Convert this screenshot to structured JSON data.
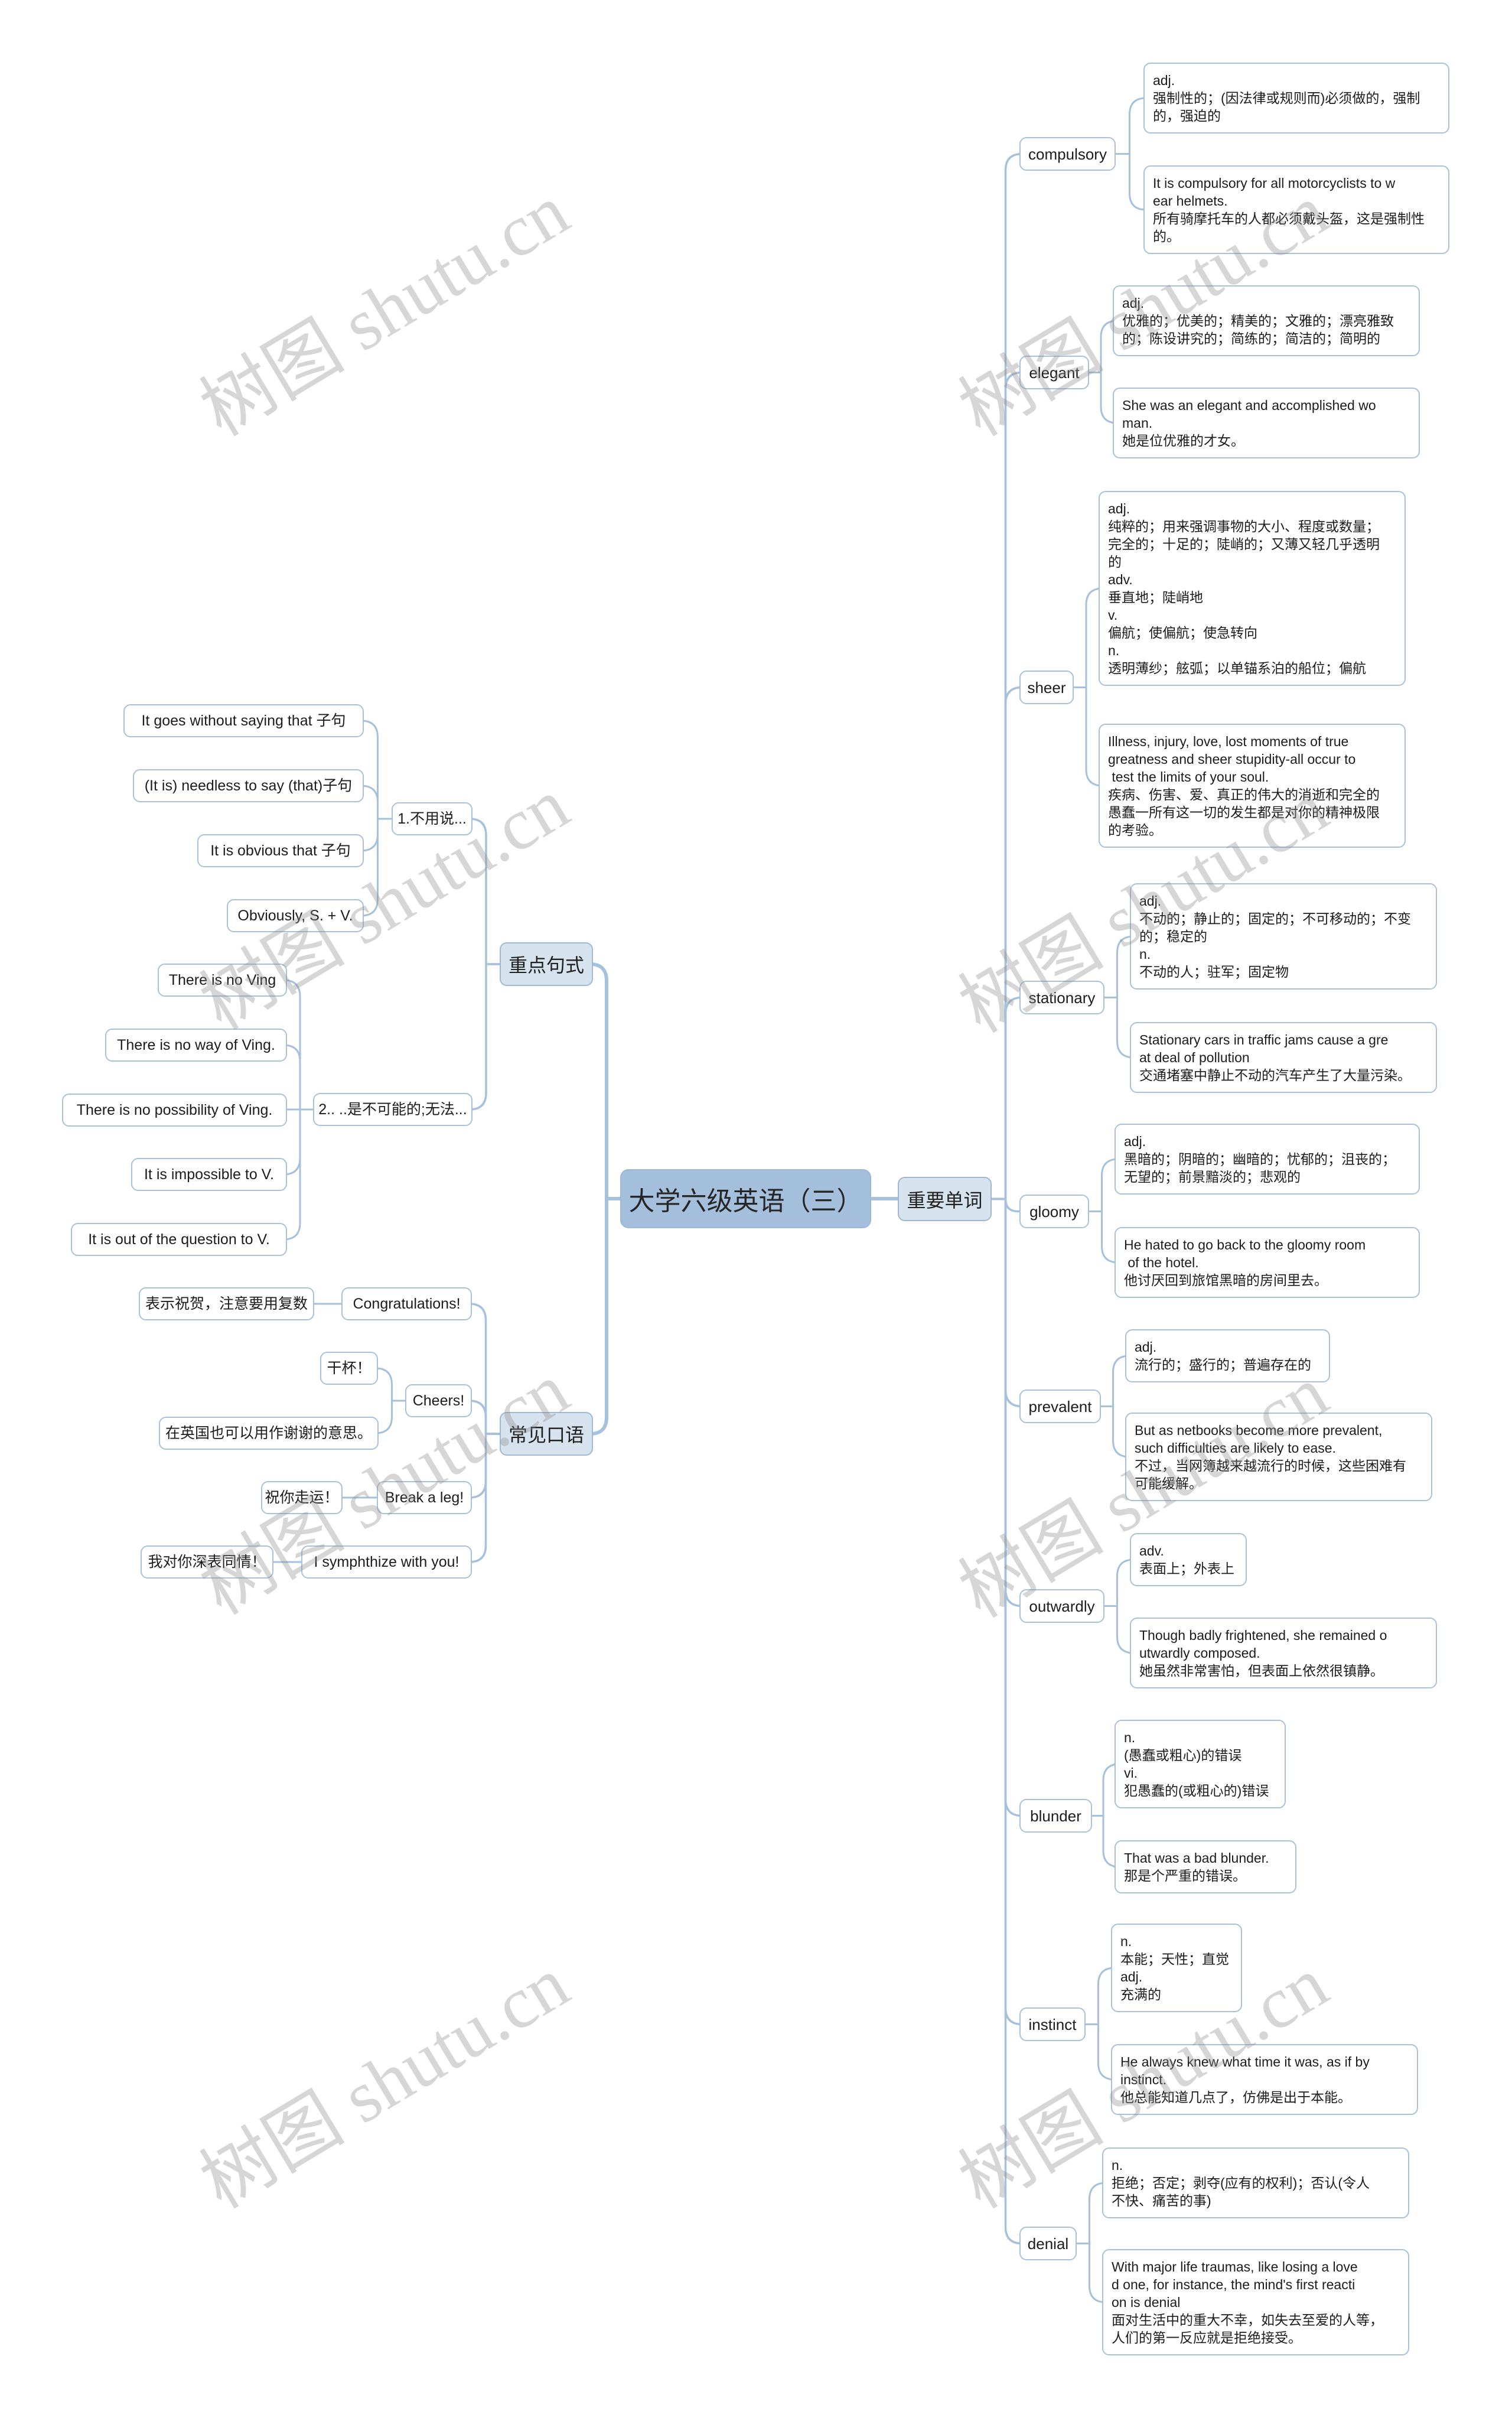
{
  "title": "大学六级英语（三）",
  "watermark": "树图 shutu.cn",
  "theme": {
    "central_fill": "#a3bfdc",
    "branch_fill": "#d6e2ed",
    "node_border": "#a9c1d9",
    "connector": "#a6c1db"
  },
  "key_sentences": {
    "label": "重点句式",
    "groups": [
      {
        "label": "1.不用说...",
        "patterns": [
          "It goes without saying that 子句",
          "(It is) needless to say (that)子句",
          "It is obvious that 子句",
          "Obviously, S. + V."
        ]
      },
      {
        "label": "2.. ..是不可能的;无法...",
        "patterns": [
          "There is no Ving",
          "There is no way of Ving.",
          "There is no possibility of Ving.",
          "It is impossible to V.",
          "It is out of the question to V."
        ]
      }
    ]
  },
  "common_phrases": {
    "label": "常见口语",
    "items": [
      {
        "phrase": "Congratulations!",
        "notes": [
          "表示祝贺，注意要用复数"
        ]
      },
      {
        "phrase": "Cheers!",
        "notes": [
          "干杯！",
          "在英国也可以用作谢谢的意思。"
        ]
      },
      {
        "phrase": "Break a leg!",
        "notes": [
          "祝你走运！"
        ]
      },
      {
        "phrase": "I symphthize with you!",
        "notes": [
          "我对你深表同情！"
        ]
      }
    ]
  },
  "important_words": {
    "label": "重要单词",
    "items": [
      {
        "word": "compulsory",
        "definition": "adj.\n强制性的；(因法律或规则而)必须做的，强制\n的，强迫的",
        "example": "It is compulsory for all motorcyclists to w\near helmets.\n所有骑摩托车的人都必须戴头盔，这是强制性\n的。"
      },
      {
        "word": "elegant",
        "definition": "adj.\n优雅的；优美的；精美的；文雅的；漂亮雅致\n的；陈设讲究的；简练的；简洁的；简明的",
        "example": "She was an elegant and accomplished wo\nman.\n她是位优雅的才女。"
      },
      {
        "word": "sheer",
        "definition": "adj.\n纯粹的；用来强调事物的大小、程度或数量；\n完全的；十足的；陡峭的；又薄又轻几乎透明\n的\nadv.\n垂直地；陡峭地\nv.\n偏航；使偏航；使急转向\nn.\n透明薄纱；舷弧；以单锚系泊的船位；偏航",
        "example": "Illness, injury, love, lost moments of true\ngreatness and sheer stupidity-all occur to\n test the limits of your soul.\n疾病、伤害、爱、真正的伟大的消逝和完全的\n愚蠢一所有这一切的发生都是对你的精神极限\n的考验。"
      },
      {
        "word": "stationary",
        "definition": "adj.\n不动的；静止的；固定的；不可移动的；不变\n的；稳定的\nn.\n不动的人；驻军；固定物",
        "example": "Stationary cars in traffic jams cause a gre\nat deal of pollution\n交通堵塞中静止不动的汽车产生了大量污染。"
      },
      {
        "word": "gloomy",
        "definition": "adj.\n黑暗的；阴暗的；幽暗的；忧郁的；沮丧的；\n无望的；前景黯淡的；悲观的",
        "example": "He hated to go back to the gloomy room\n of the hotel.\n他讨厌回到旅馆黑暗的房间里去。"
      },
      {
        "word": "prevalent",
        "definition": "adj.\n流行的；盛行的；普遍存在的",
        "example": "But as netbooks become more prevalent,\nsuch difficulties are likely to ease.\n不过，当网簿越来越流行的时候，这些困难有\n可能缓解。"
      },
      {
        "word": "outwardly",
        "definition": "adv.\n表面上；外表上",
        "example": "Though badly frightened, she remained o\nutwardly composed.\n她虽然非常害怕，但表面上依然很镇静。"
      },
      {
        "word": "blunder",
        "definition": "n.\n(愚蠢或粗心)的错误\nvi.\n犯愚蠢的(或粗心的)错误",
        "example": "That was a bad blunder.\n那是个严重的错误。"
      },
      {
        "word": "instinct",
        "definition": "n.\n本能；天性；直觉\nadj.\n充满的",
        "example": "He always knew what time it was, as if by\ninstinct.\n他总能知道几点了，仿佛是出于本能。"
      },
      {
        "word": "denial",
        "definition": "n.\n拒绝；否定；剥夺(应有的权利)；否认(令人\n不快、痛苦的事)",
        "example": "With major life traumas, like losing a love\nd one, for instance, the mind's first reacti\non is denial\n面对生活中的重大不幸，如失去至爱的人等，\n人们的第一反应就是拒绝接受。"
      }
    ]
  }
}
